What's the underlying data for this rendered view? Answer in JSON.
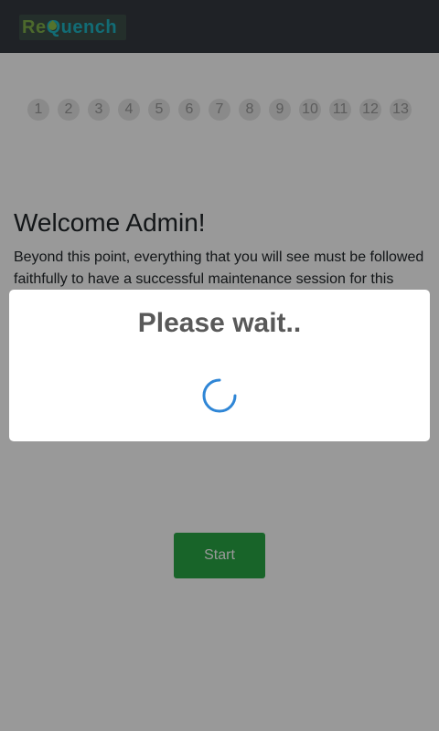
{
  "header": {
    "logo": {
      "part1": "Re",
      "part2": "Q",
      "part3": "uench"
    }
  },
  "steps": [
    "1",
    "2",
    "3",
    "4",
    "5",
    "6",
    "7",
    "8",
    "9",
    "10",
    "11",
    "12",
    "13"
  ],
  "main": {
    "title": "Welcome Admin!",
    "intro": "Beyond this point, everything that you will see must be followed faithfully to have a successful maintenance session for this",
    "start_label": "Start"
  },
  "modal": {
    "title": "Please wait..",
    "spinner_icon": "loading-spinner-icon",
    "spinner_color": "#2f86d6"
  },
  "colors": {
    "header_bg": "#343a40",
    "start_button": "#28a745",
    "logo_green": "#7fb04a",
    "logo_teal": "#1fb5c4"
  }
}
